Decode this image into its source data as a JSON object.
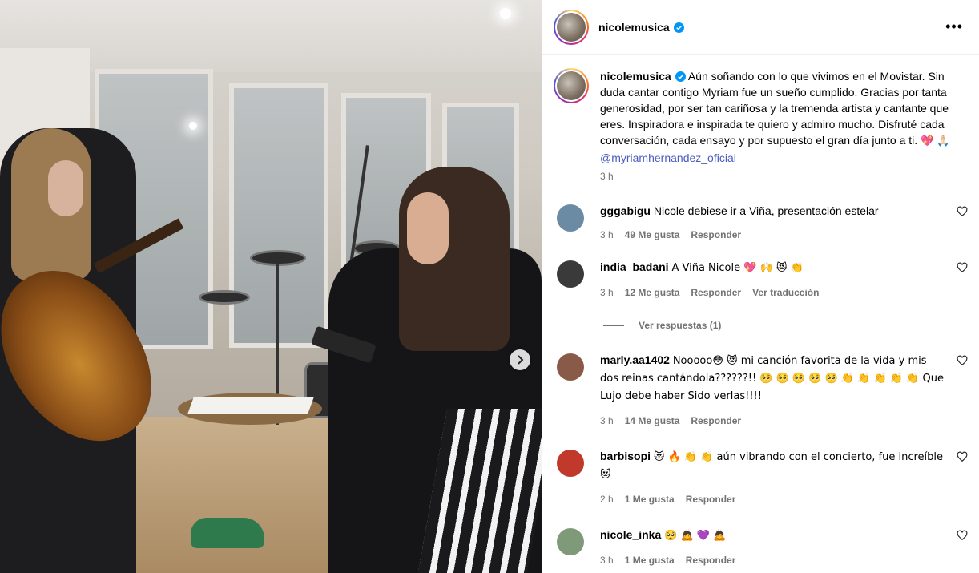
{
  "post": {
    "username": "nicolemusica",
    "caption": "Aún soñando con lo que vivimos en el Movistar. Sin duda cantar contigo Myriam fue un sueño cumplido. Gracias por tanta generosidad, por ser tan cariñosa y la tremenda artista y cantante que eres. Inspiradora e inspirada te quiero y admiro mucho. Disfruté cada conversación, cada ensayo y por supuesto el gran día junto a ti.",
    "caption_emojis": "💖 🙏🏻",
    "mention": "@myriamhernandez_oficial",
    "time": "3 h"
  },
  "comments": [
    {
      "username": "gggabigu",
      "text": "Nicole debiese ir a Viña, presentación estelar",
      "time": "3 h",
      "likes": "49 Me gusta",
      "reply": "Responder",
      "avatar_color": "#6b8aa3"
    },
    {
      "username": "india_badani",
      "text": "A Viña Nicole 💖 🙌 😻 👏",
      "time": "3 h",
      "likes": "12 Me gusta",
      "reply": "Responder",
      "translate": "Ver traducción",
      "avatar_color": "#3a3a3a",
      "view_replies": "Ver respuestas (1)"
    },
    {
      "username": "marly.aa1402",
      "text": "Nooooo😳 😻  mi canción favorita de la vida y mis dos reinas cantándola??????!! 🥺 🥺 🥺 🥺 🥺  👏 👏 👏 👏 👏 Que Lujo debe haber Sido verlas!!!!",
      "time": "3 h",
      "likes": "14 Me gusta",
      "reply": "Responder",
      "avatar_color": "#8a5a48"
    },
    {
      "username": "barbisopi",
      "text": "😻 🔥 👏 👏  aún vibrando con el concierto, fue increíble 😻",
      "time": "2 h",
      "likes": "1 Me gusta",
      "reply": "Responder",
      "avatar_color": "#c0392b"
    },
    {
      "username": "nicole_inka",
      "text": "🥺 🙇 💜 🙇",
      "time": "3 h",
      "likes": "1 Me gusta",
      "reply": "Responder",
      "avatar_color": "#7f9a78"
    }
  ],
  "icons": {
    "verified": "verified-badge-icon",
    "more": "more-options-icon",
    "like": "heart-icon",
    "next": "chevron-right-icon"
  },
  "colors": {
    "verified_blue": "#0095f6",
    "mention_blue": "#4a5dbf",
    "meta_gray": "#737373"
  }
}
